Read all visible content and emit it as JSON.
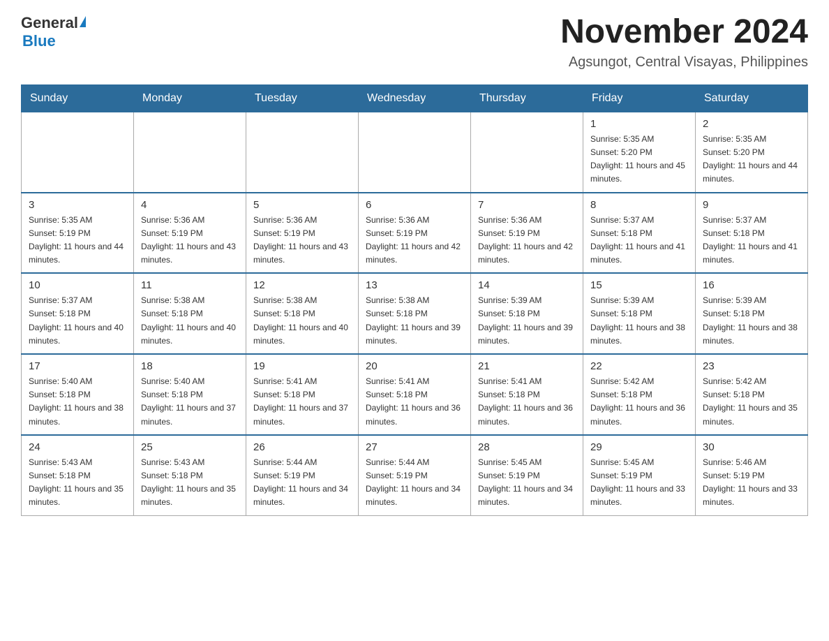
{
  "header": {
    "logo_general": "General",
    "logo_blue": "Blue",
    "month_title": "November 2024",
    "location": "Agsungot, Central Visayas, Philippines"
  },
  "days_of_week": [
    "Sunday",
    "Monday",
    "Tuesday",
    "Wednesday",
    "Thursday",
    "Friday",
    "Saturday"
  ],
  "weeks": [
    [
      {
        "day": "",
        "sunrise": "",
        "sunset": "",
        "daylight": ""
      },
      {
        "day": "",
        "sunrise": "",
        "sunset": "",
        "daylight": ""
      },
      {
        "day": "",
        "sunrise": "",
        "sunset": "",
        "daylight": ""
      },
      {
        "day": "",
        "sunrise": "",
        "sunset": "",
        "daylight": ""
      },
      {
        "day": "",
        "sunrise": "",
        "sunset": "",
        "daylight": ""
      },
      {
        "day": "1",
        "sunrise": "Sunrise: 5:35 AM",
        "sunset": "Sunset: 5:20 PM",
        "daylight": "Daylight: 11 hours and 45 minutes."
      },
      {
        "day": "2",
        "sunrise": "Sunrise: 5:35 AM",
        "sunset": "Sunset: 5:20 PM",
        "daylight": "Daylight: 11 hours and 44 minutes."
      }
    ],
    [
      {
        "day": "3",
        "sunrise": "Sunrise: 5:35 AM",
        "sunset": "Sunset: 5:19 PM",
        "daylight": "Daylight: 11 hours and 44 minutes."
      },
      {
        "day": "4",
        "sunrise": "Sunrise: 5:36 AM",
        "sunset": "Sunset: 5:19 PM",
        "daylight": "Daylight: 11 hours and 43 minutes."
      },
      {
        "day": "5",
        "sunrise": "Sunrise: 5:36 AM",
        "sunset": "Sunset: 5:19 PM",
        "daylight": "Daylight: 11 hours and 43 minutes."
      },
      {
        "day": "6",
        "sunrise": "Sunrise: 5:36 AM",
        "sunset": "Sunset: 5:19 PM",
        "daylight": "Daylight: 11 hours and 42 minutes."
      },
      {
        "day": "7",
        "sunrise": "Sunrise: 5:36 AM",
        "sunset": "Sunset: 5:19 PM",
        "daylight": "Daylight: 11 hours and 42 minutes."
      },
      {
        "day": "8",
        "sunrise": "Sunrise: 5:37 AM",
        "sunset": "Sunset: 5:18 PM",
        "daylight": "Daylight: 11 hours and 41 minutes."
      },
      {
        "day": "9",
        "sunrise": "Sunrise: 5:37 AM",
        "sunset": "Sunset: 5:18 PM",
        "daylight": "Daylight: 11 hours and 41 minutes."
      }
    ],
    [
      {
        "day": "10",
        "sunrise": "Sunrise: 5:37 AM",
        "sunset": "Sunset: 5:18 PM",
        "daylight": "Daylight: 11 hours and 40 minutes."
      },
      {
        "day": "11",
        "sunrise": "Sunrise: 5:38 AM",
        "sunset": "Sunset: 5:18 PM",
        "daylight": "Daylight: 11 hours and 40 minutes."
      },
      {
        "day": "12",
        "sunrise": "Sunrise: 5:38 AM",
        "sunset": "Sunset: 5:18 PM",
        "daylight": "Daylight: 11 hours and 40 minutes."
      },
      {
        "day": "13",
        "sunrise": "Sunrise: 5:38 AM",
        "sunset": "Sunset: 5:18 PM",
        "daylight": "Daylight: 11 hours and 39 minutes."
      },
      {
        "day": "14",
        "sunrise": "Sunrise: 5:39 AM",
        "sunset": "Sunset: 5:18 PM",
        "daylight": "Daylight: 11 hours and 39 minutes."
      },
      {
        "day": "15",
        "sunrise": "Sunrise: 5:39 AM",
        "sunset": "Sunset: 5:18 PM",
        "daylight": "Daylight: 11 hours and 38 minutes."
      },
      {
        "day": "16",
        "sunrise": "Sunrise: 5:39 AM",
        "sunset": "Sunset: 5:18 PM",
        "daylight": "Daylight: 11 hours and 38 minutes."
      }
    ],
    [
      {
        "day": "17",
        "sunrise": "Sunrise: 5:40 AM",
        "sunset": "Sunset: 5:18 PM",
        "daylight": "Daylight: 11 hours and 38 minutes."
      },
      {
        "day": "18",
        "sunrise": "Sunrise: 5:40 AM",
        "sunset": "Sunset: 5:18 PM",
        "daylight": "Daylight: 11 hours and 37 minutes."
      },
      {
        "day": "19",
        "sunrise": "Sunrise: 5:41 AM",
        "sunset": "Sunset: 5:18 PM",
        "daylight": "Daylight: 11 hours and 37 minutes."
      },
      {
        "day": "20",
        "sunrise": "Sunrise: 5:41 AM",
        "sunset": "Sunset: 5:18 PM",
        "daylight": "Daylight: 11 hours and 36 minutes."
      },
      {
        "day": "21",
        "sunrise": "Sunrise: 5:41 AM",
        "sunset": "Sunset: 5:18 PM",
        "daylight": "Daylight: 11 hours and 36 minutes."
      },
      {
        "day": "22",
        "sunrise": "Sunrise: 5:42 AM",
        "sunset": "Sunset: 5:18 PM",
        "daylight": "Daylight: 11 hours and 36 minutes."
      },
      {
        "day": "23",
        "sunrise": "Sunrise: 5:42 AM",
        "sunset": "Sunset: 5:18 PM",
        "daylight": "Daylight: 11 hours and 35 minutes."
      }
    ],
    [
      {
        "day": "24",
        "sunrise": "Sunrise: 5:43 AM",
        "sunset": "Sunset: 5:18 PM",
        "daylight": "Daylight: 11 hours and 35 minutes."
      },
      {
        "day": "25",
        "sunrise": "Sunrise: 5:43 AM",
        "sunset": "Sunset: 5:18 PM",
        "daylight": "Daylight: 11 hours and 35 minutes."
      },
      {
        "day": "26",
        "sunrise": "Sunrise: 5:44 AM",
        "sunset": "Sunset: 5:19 PM",
        "daylight": "Daylight: 11 hours and 34 minutes."
      },
      {
        "day": "27",
        "sunrise": "Sunrise: 5:44 AM",
        "sunset": "Sunset: 5:19 PM",
        "daylight": "Daylight: 11 hours and 34 minutes."
      },
      {
        "day": "28",
        "sunrise": "Sunrise: 5:45 AM",
        "sunset": "Sunset: 5:19 PM",
        "daylight": "Daylight: 11 hours and 34 minutes."
      },
      {
        "day": "29",
        "sunrise": "Sunrise: 5:45 AM",
        "sunset": "Sunset: 5:19 PM",
        "daylight": "Daylight: 11 hours and 33 minutes."
      },
      {
        "day": "30",
        "sunrise": "Sunrise: 5:46 AM",
        "sunset": "Sunset: 5:19 PM",
        "daylight": "Daylight: 11 hours and 33 minutes."
      }
    ]
  ]
}
